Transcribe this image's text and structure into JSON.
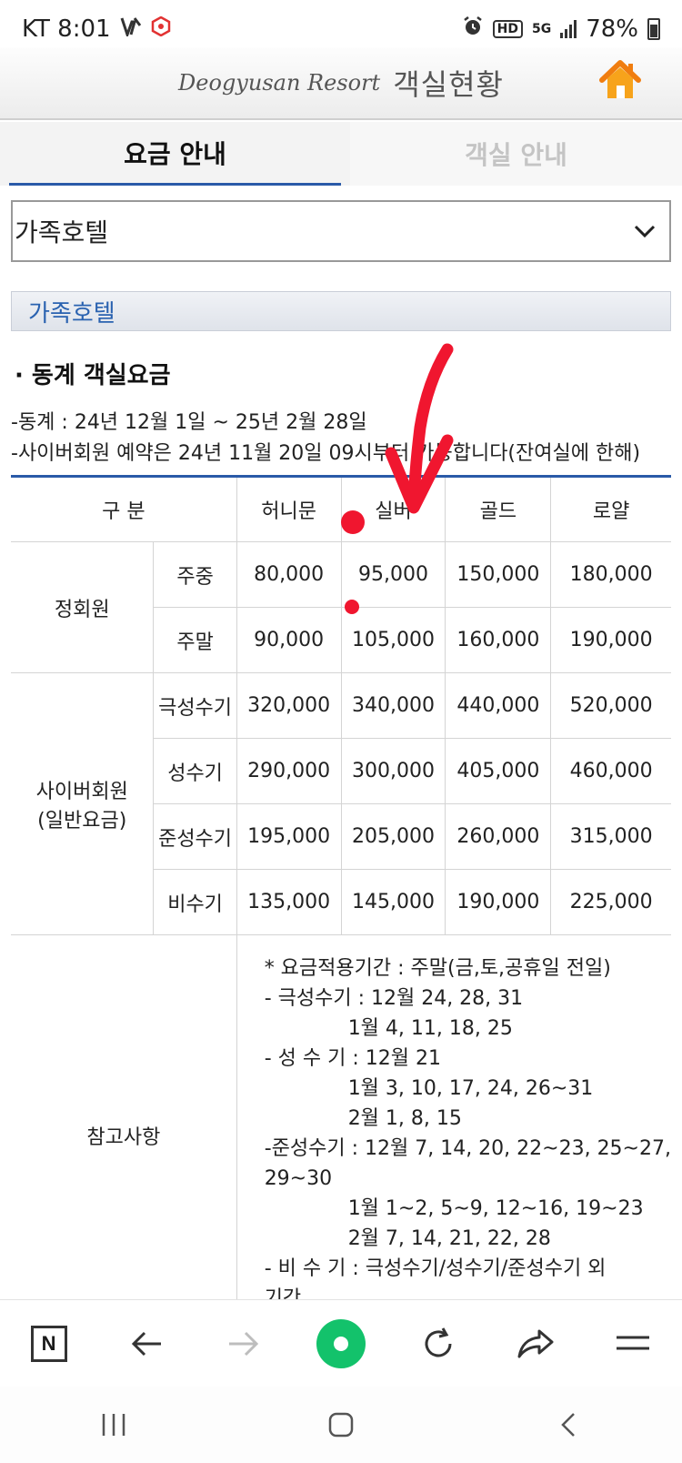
{
  "status": {
    "carrier_time": "KT 8:01",
    "network": "5G",
    "hd": "HD",
    "battery": "78%"
  },
  "header": {
    "brand": "Deogyusan Resort",
    "title": "객실현황"
  },
  "tabs": [
    {
      "label": "요금 안내",
      "active": true
    },
    {
      "label": "객실 안내",
      "active": false
    }
  ],
  "select": {
    "value": "가족호텔"
  },
  "section": {
    "title": "가족호텔"
  },
  "rates": {
    "heading": "· 동계 객실요금",
    "period": "-동계 : 24년 12월 1일 ~ 25년 2월 28일",
    "reservation": "-사이버회원 예약은 24년 11월 20일 09시부터 가능합니다(잔여실에 한해)",
    "table": {
      "header_label": "구 분",
      "columns": [
        "허니문",
        "실버",
        "골드",
        "로얄"
      ],
      "groups": [
        {
          "label": "정회원",
          "label_line2": "",
          "rows": [
            {
              "type": "주중",
              "prices": [
                "80,000",
                "95,000",
                "150,000",
                "180,000"
              ]
            },
            {
              "type": "주말",
              "prices": [
                "90,000",
                "105,000",
                "160,000",
                "190,000"
              ]
            }
          ]
        },
        {
          "label": "사이버회원",
          "label_line2": "(일반요금)",
          "rows": [
            {
              "type": "극성수기",
              "prices": [
                "320,000",
                "340,000",
                "440,000",
                "520,000"
              ]
            },
            {
              "type": "성수기",
              "prices": [
                "290,000",
                "300,000",
                "405,000",
                "460,000"
              ]
            },
            {
              "type": "준성수기",
              "prices": [
                "195,000",
                "205,000",
                "260,000",
                "315,000"
              ]
            },
            {
              "type": "비수기",
              "prices": [
                "135,000",
                "145,000",
                "190,000",
                "225,000"
              ]
            }
          ]
        }
      ],
      "notes_label": "참고사항",
      "notes": [
        "* 요금적용기간 : 주말(금,토,공휴일 전일)",
        "- 극성수기 : 12월 24, 28, 31",
        "1월 4, 11, 18, 25",
        "- 성 수 기 : 12월 21",
        "1월 3, 10, 17, 24, 26~31",
        "2월 1, 8, 15",
        "-준성수기 : 12월 7, 14, 20, 22~23, 25~27,",
        "29~30",
        "1월 1~2, 5~9, 12~16, 19~23",
        "2월 7, 14, 21, 22, 28",
        "- 비 수 기  : 극성수기/성수기/준성수기 외",
        "기간"
      ]
    }
  },
  "colors": {
    "accent_blue": "#2a5aa8",
    "section_text": "#2a62b0",
    "annotation_red": "#f0162f",
    "home_orange": "#f07d0f",
    "naver_green": "#13c26b"
  },
  "toolbar_icons": [
    "naver-n-icon",
    "back-arrow-icon",
    "forward-arrow-icon",
    "naver-green-dot-icon",
    "refresh-icon",
    "share-icon",
    "menu-icon"
  ]
}
